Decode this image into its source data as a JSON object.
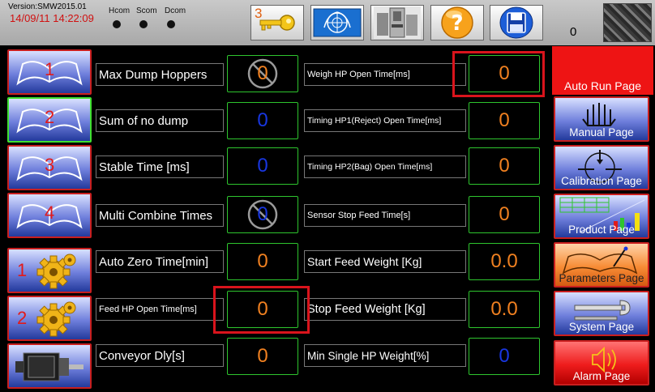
{
  "header": {
    "version": "Version:SMW2015.01",
    "datetime": "14/09/11 14:22:09",
    "com_labels": [
      "Hcom",
      "Scom",
      "Dcom"
    ],
    "key_count": "3",
    "counter": "0"
  },
  "left_buttons": [
    {
      "label": "1",
      "icon": "book-icon"
    },
    {
      "label": "2",
      "icon": "book-icon"
    },
    {
      "label": "3",
      "icon": "book-icon"
    },
    {
      "label": "4",
      "icon": "book-icon"
    },
    {
      "label": "1",
      "icon": "gear-icon"
    },
    {
      "label": "2",
      "icon": "gear-icon"
    },
    {
      "label": "",
      "icon": "motor-icon"
    }
  ],
  "params_left": [
    {
      "label": "Max Dump Hoppers",
      "value": "0"
    },
    {
      "label": "Sum of no dump",
      "value": "0"
    },
    {
      "label": "Stable Time [ms]",
      "value": "0"
    },
    {
      "label": "Multi Combine Times",
      "value": "0"
    },
    {
      "label": "Auto Zero Time[min]",
      "value": "0"
    },
    {
      "label": "Feed HP Open Time[ms]",
      "value": "0"
    },
    {
      "label": "Conveyor Dly[s]",
      "value": "0"
    }
  ],
  "params_right": [
    {
      "label": "Weigh HP Open Time[ms]",
      "value": "0"
    },
    {
      "label": "Timing HP1(Reject) Open Time[ms]",
      "value": "0"
    },
    {
      "label": "Timing HP2(Bag) Open Time[ms]",
      "value": "0"
    },
    {
      "label": "Sensor Stop Feed Time[s]",
      "value": "0"
    },
    {
      "label": "Start Feed Weight [Kg]",
      "value": "0.0"
    },
    {
      "label": "Stop Feed Weight [Kg]",
      "value": "0.0"
    },
    {
      "label": "Min Single HP Weight[%]",
      "value": "0"
    }
  ],
  "nav": {
    "auto_run": "Auto Run Page",
    "manual": "Manual Page",
    "calibration": "Calibration Page",
    "product": "Product Page",
    "parameters": "Parameters Page",
    "system": "System Page",
    "alarm": "Alarm Page"
  },
  "colors": {
    "accent_red": "#ee1414",
    "value_orange": "#f08020",
    "value_blue": "#1836e0",
    "border_green": "#2ec52e"
  }
}
